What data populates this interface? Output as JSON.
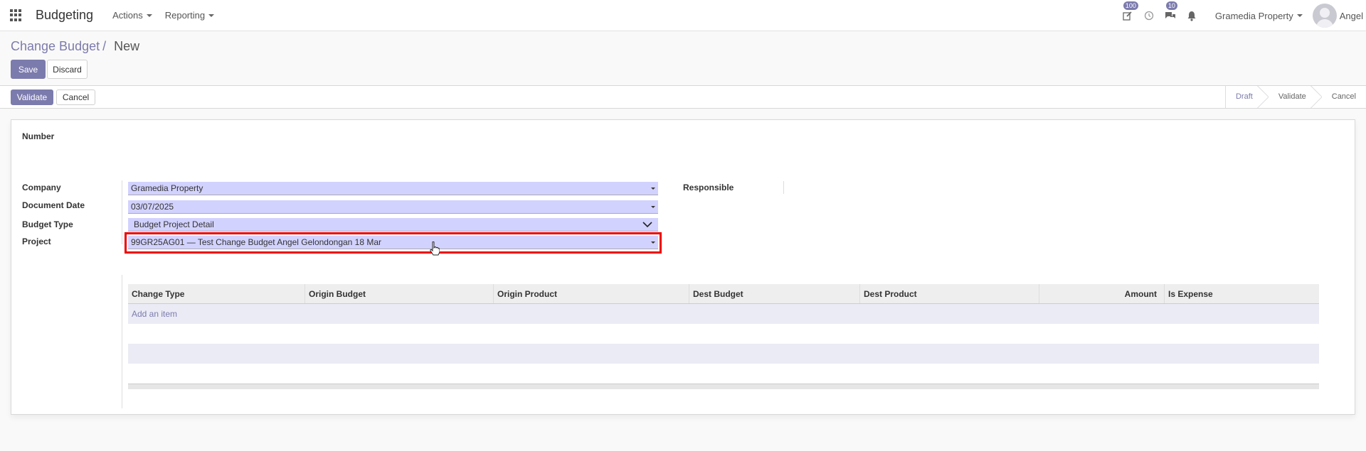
{
  "navbar": {
    "app_title": "Budgeting",
    "menus": [
      "Actions",
      "Reporting"
    ],
    "activity_badge": "100",
    "messages_badge": "10",
    "company": "Gramedia Property",
    "user": "Angel"
  },
  "breadcrumb": {
    "parent": "Change Budget",
    "current": "New"
  },
  "buttons": {
    "save": "Save",
    "discard": "Discard",
    "validate": "Validate",
    "cancel": "Cancel"
  },
  "statusbar": {
    "stages": [
      "Draft",
      "Validate",
      "Cancel"
    ],
    "active_stage": "Draft"
  },
  "form": {
    "number_label": "Number",
    "company_label": "Company",
    "company_value": "Gramedia Property",
    "document_date_label": "Document Date",
    "document_date_value": "03/07/2025",
    "budget_type_label": "Budget Type",
    "budget_type_value": "Budget Project Detail",
    "project_label": "Project",
    "project_value": "99GR25AG01 — Test Change Budget Angel Gelondongan 18 Mar",
    "responsible_label": "Responsible"
  },
  "lines_table": {
    "columns": [
      "Change Type",
      "Origin Budget",
      "Origin Product",
      "Dest Budget",
      "Dest Product",
      "Amount",
      "Is Expense"
    ],
    "add_item": "Add an item"
  },
  "colors": {
    "primary": "#7c7bad",
    "field_bg": "#d2d2ff",
    "highlight": "#e00000"
  }
}
